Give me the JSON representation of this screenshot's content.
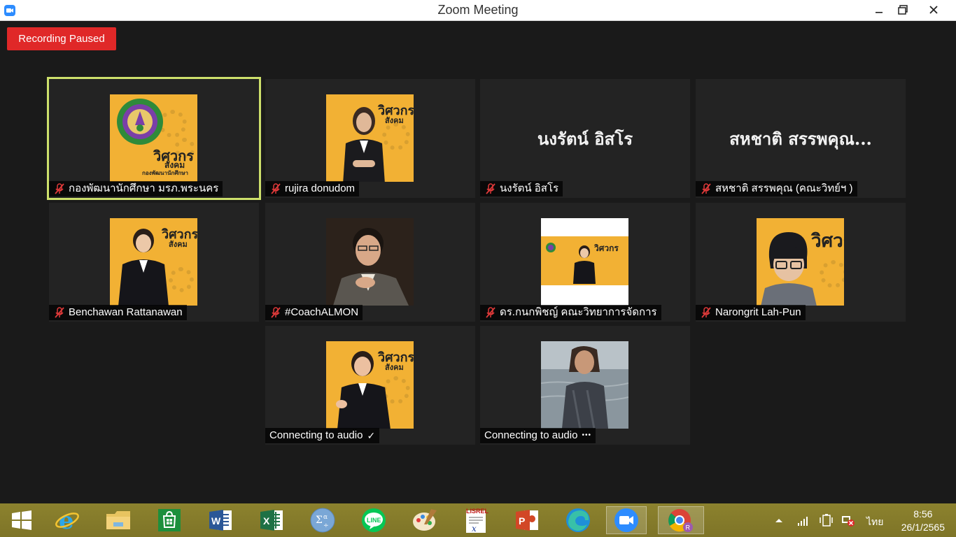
{
  "window": {
    "title": "Zoom Meeting",
    "controls": [
      "minimize",
      "maximize",
      "close"
    ]
  },
  "recording": {
    "label": "Recording Paused",
    "color": "#e02828"
  },
  "active_speaker_color": "#cde06b",
  "participants": [
    {
      "name": "กองพัฒนานักศึกษา มรภ.พระนคร",
      "muted": true,
      "view": "poster-logo",
      "active": true
    },
    {
      "name": "rujira donudom",
      "muted": true,
      "view": "poster-woman"
    },
    {
      "name": "นงรัตน์ อิสโร",
      "muted": true,
      "view": "name-only",
      "display_name": "นงรัตน์ อิสโร"
    },
    {
      "name": "สหชาติ สรรพคุณ (คณะวิทย์ฯ )",
      "muted": true,
      "view": "name-only",
      "display_name": "สหชาติ สรรพคุณ..."
    },
    {
      "name": "Benchawan Rattanawan",
      "muted": true,
      "view": "poster-woman"
    },
    {
      "name": "#CoachALMON",
      "muted": true,
      "view": "photo-man"
    },
    {
      "name": "ดร.กนกพิชญ์ คณะวิทยาการจัดการ",
      "muted": true,
      "view": "poster-small"
    },
    {
      "name": "Narongrit Lah-Pun",
      "muted": true,
      "view": "poster-avatar"
    },
    {
      "name": "Connecting to audio",
      "muted": false,
      "status_icon": "checkmark-icon",
      "status_text": "✓",
      "view": "poster-woman"
    },
    {
      "name": "Connecting to audio",
      "muted": false,
      "status_icon": "ellipsis-icon",
      "status_text": "•••",
      "view": "photo-sea"
    }
  ],
  "poster": {
    "line1": "วิศวกร",
    "line2": "สังคม",
    "line3": "กองพัฒนานักศึกษา",
    "line4": "มหาวิทยาลัยราชภัฏพระนคร"
  },
  "taskbar": {
    "apps": [
      "start",
      "internet-explorer",
      "file-explorer",
      "store",
      "word",
      "excel",
      "math-input",
      "line",
      "paint",
      "lisrel",
      "powerpoint",
      "edge",
      "zoom",
      "chrome"
    ],
    "line_label": "LINE",
    "lisrel_label": "LISREL",
    "language": "ไทย",
    "time": "8:56",
    "date": "26/1/2565"
  }
}
